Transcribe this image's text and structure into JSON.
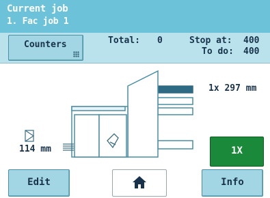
{
  "header": {
    "title_line1": "Current job",
    "title_line2": "1. Fac job 1"
  },
  "counters": {
    "button_label": "Counters",
    "total_label": "Total:",
    "total_value": "0",
    "stop_at_label": "Stop at:",
    "stop_at_value": "400",
    "to_do_label": "To do:",
    "to_do_value": "400"
  },
  "job": {
    "insert_measure": "1x  297 mm",
    "envelope_measure": "114 mm",
    "quantity_label": "1X"
  },
  "bottom": {
    "edit_label": "Edit",
    "info_label": "Info",
    "home_icon": "home-icon"
  },
  "colors": {
    "header_bg": "#6cc2d8",
    "counters_bg": "#b9e2ec",
    "button_bg": "#a3d6e4",
    "quantity_bg": "#1a8a3a",
    "machine_stroke": "#4a8ea2"
  }
}
